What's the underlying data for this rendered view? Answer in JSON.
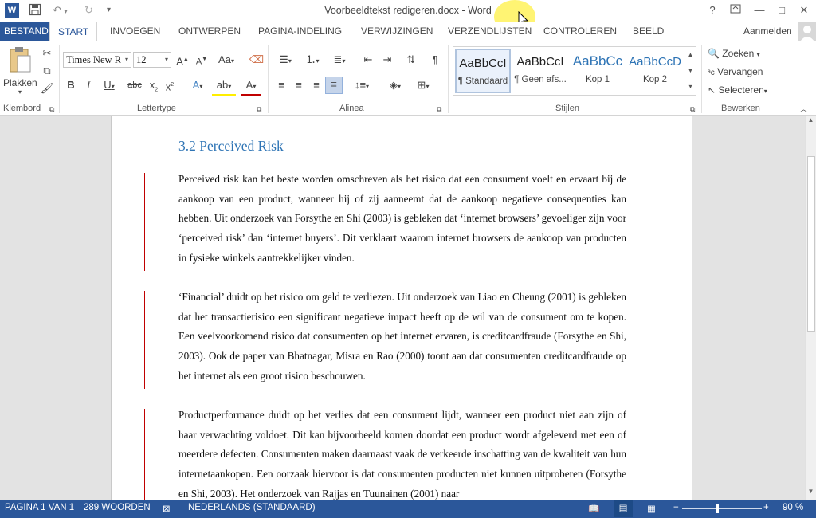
{
  "titlebar": {
    "title": "Voorbeeldtekst redigeren.docx - Word",
    "app_icon": "W",
    "help": "?",
    "minimize": "—",
    "maximize": "□",
    "close": "✕"
  },
  "tabs": [
    "BESTAND",
    "START",
    "INVOEGEN",
    "ONTWERPEN",
    "PAGINA-INDELING",
    "VERWIJZINGEN",
    "VERZENDLIJSTEN",
    "CONTROLEREN",
    "BEELD"
  ],
  "signin": "Aanmelden",
  "ribbon": {
    "clipboard": {
      "label": "Klembord",
      "paste": "Plakken"
    },
    "font": {
      "label": "Lettertype",
      "font_name": "Times New R",
      "font_size": "12"
    },
    "paragraph": {
      "label": "Alinea"
    },
    "styles": {
      "label": "Stijlen",
      "items": [
        {
          "sample": "AaBbCcI",
          "name": "¶ Standaard"
        },
        {
          "sample": "AaBbCcI",
          "name": "¶ Geen afs..."
        },
        {
          "sample": "AaBbCc",
          "name": "Kop 1"
        },
        {
          "sample": "AaBbCcD",
          "name": "Kop 2"
        }
      ]
    },
    "editing": {
      "label": "Bewerken",
      "find": "Zoeken",
      "replace": "Vervangen",
      "select": "Selecteren"
    }
  },
  "document": {
    "heading": "3.2 Perceived Risk",
    "paragraphs": [
      "Perceived risk kan het beste worden omschreven als het risico dat een consument voelt en ervaart bij de aankoop van een product, wanneer hij of zij aanneemt dat de aankoop negatieve consequenties kan hebben. Uit onderzoek van Forsythe en Shi (2003) is gebleken dat ‘internet browsers’ gevoeliger zijn voor ‘perceived risk’ dan ‘internet buyers’. Dit verklaart waarom internet browsers de aankoop van producten in fysieke winkels aantrekkelijker vinden.",
      "‘Financial’ duidt op het risico om geld te verliezen. Uit onderzoek van Liao en Cheung (2001) is gebleken dat het transactierisico een significant negatieve impact heeft op de wil van de consument om te kopen. Een veelvoorkomend risico dat consumenten op het internet ervaren, is creditcardfraude (Forsythe en Shi, 2003). Ook de paper van Bhatnagar, Misra en Rao (2000) toont aan dat consumenten creditcardfraude op het internet als een groot risico beschouwen.",
      "Productperformance duidt op het verlies dat een consument lijdt, wanneer een product niet aan zijn of haar verwachting voldoet. Dit kan bijvoorbeeld komen doordat een product wordt afgeleverd met een of meerdere defecten. Consumenten maken daarnaast vaak de verkeerde inschatting van de kwaliteit van hun internetaankopen. Een oorzaak hiervoor is dat consumenten producten niet kunnen uitproberen (Forsythe en Shi, 2003). Het onderzoek van Rajjas en Tuunainen (2001) naar"
    ]
  },
  "statusbar": {
    "page": "PAGINA 1 VAN 1",
    "words": "289 WOORDEN",
    "language": "NEDERLANDS (STANDAARD)",
    "zoom": "90 %"
  }
}
